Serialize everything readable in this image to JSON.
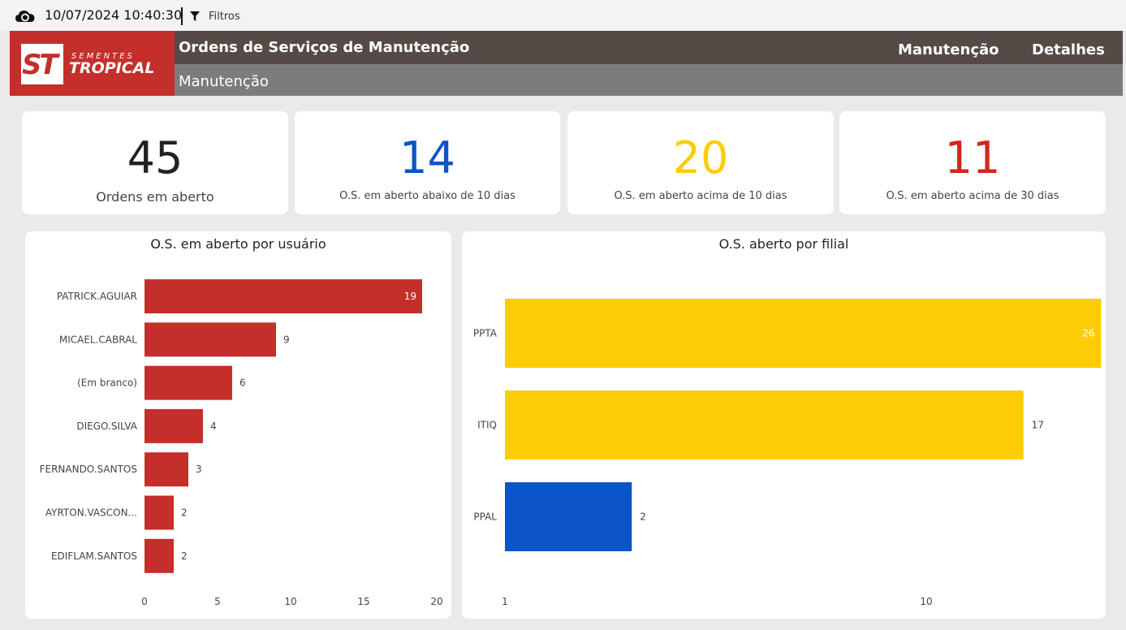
{
  "toolbar": {
    "timestamp": "10/07/2024 10:40:30",
    "filters_label": "Filtros"
  },
  "header": {
    "logo_top": "SEMENTES",
    "logo_bottom": "TROPICAL",
    "title": "Ordens de Serviços de Manutenção",
    "subtitle": "Manutenção",
    "nav": [
      "Manutenção",
      "Detalhes"
    ]
  },
  "colors": {
    "brand_red": "#c42f2b",
    "blue": "#0b55c8",
    "yellow": "#fccd05",
    "dark_red": "#d3261d"
  },
  "kpis": [
    {
      "value": "45",
      "label": "Ordens em aberto",
      "color": "#222222"
    },
    {
      "value": "14",
      "label": "O.S. em aberto abaixo de 10 dias",
      "color": "#0b55c8"
    },
    {
      "value": "20",
      "label": "O.S. em aberto acima de 10 dias",
      "color": "#fccd05"
    },
    {
      "value": "11",
      "label": "O.S. em aberto acima de 30 dias",
      "color": "#d3261d"
    }
  ],
  "chart_data": [
    {
      "type": "bar",
      "orientation": "horizontal",
      "title": "O.S. em aberto por usuário",
      "categories": [
        "PATRICK.AGUIAR",
        "MICAEL.CABRAL",
        "(Em branco)",
        "DIEGO.SILVA",
        "FERNANDO.SANTOS",
        "AYRTON.VASCON...",
        "EDIFLAM.SANTOS"
      ],
      "values": [
        19,
        9,
        6,
        4,
        3,
        2,
        2
      ],
      "xlim": [
        0,
        20
      ],
      "xticks": [
        0,
        5,
        10,
        15,
        20
      ],
      "bar_color": "#c42f2b",
      "grid": false
    },
    {
      "type": "bar",
      "orientation": "horizontal",
      "title": "O.S. aberto por filial",
      "categories": [
        "PPTA",
        "ITIQ",
        "PPAL"
      ],
      "values": [
        26,
        17,
        2
      ],
      "xscale": "log",
      "xlim": [
        1,
        26
      ],
      "xticks": [
        1,
        10
      ],
      "bar_colors": [
        "#fccd05",
        "#fccd05",
        "#0b55c8"
      ],
      "grid": false
    }
  ]
}
